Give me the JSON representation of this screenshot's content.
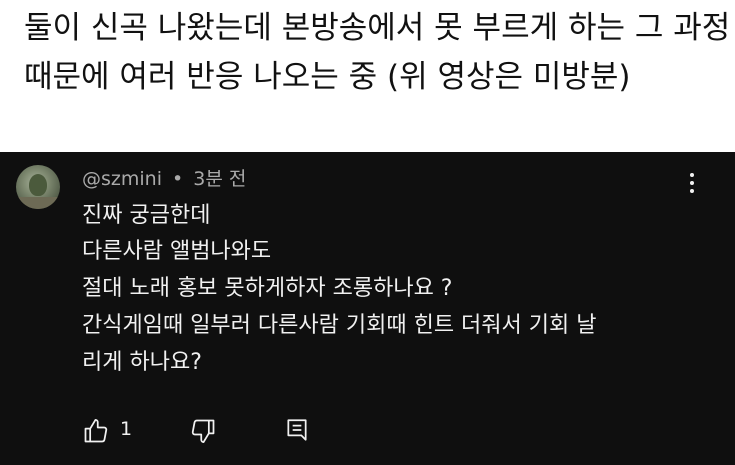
{
  "post": {
    "line1": "둘이 신곡 나왔는데 본방송에서 못 부르게 하는 그 과정",
    "line2": "때문에 여러 반응 나오는 중 (위 영상은 미방분)"
  },
  "comment": {
    "author": "@szmini",
    "separator": "•",
    "time": "3분 전",
    "lines": [
      "진짜 궁금한데",
      "다른사람 앨범나와도",
      "절대 노래 홍보 못하게하자 조롱하나요 ?",
      "간식게임때 일부러 다른사람 기회때 힌트 더줘서 기회 날",
      "리게 하나요?"
    ],
    "like_count": "1",
    "icons": {
      "like": "thumbs-up-icon",
      "dislike": "thumbs-down-icon",
      "reply": "reply-comment-icon",
      "more": "more-vertical-icon"
    }
  },
  "colors": {
    "comment_bg": "#0f0f0f",
    "primary_text": "#f1f1f1",
    "secondary_text": "#aaaaaa",
    "post_text": "#111111"
  }
}
